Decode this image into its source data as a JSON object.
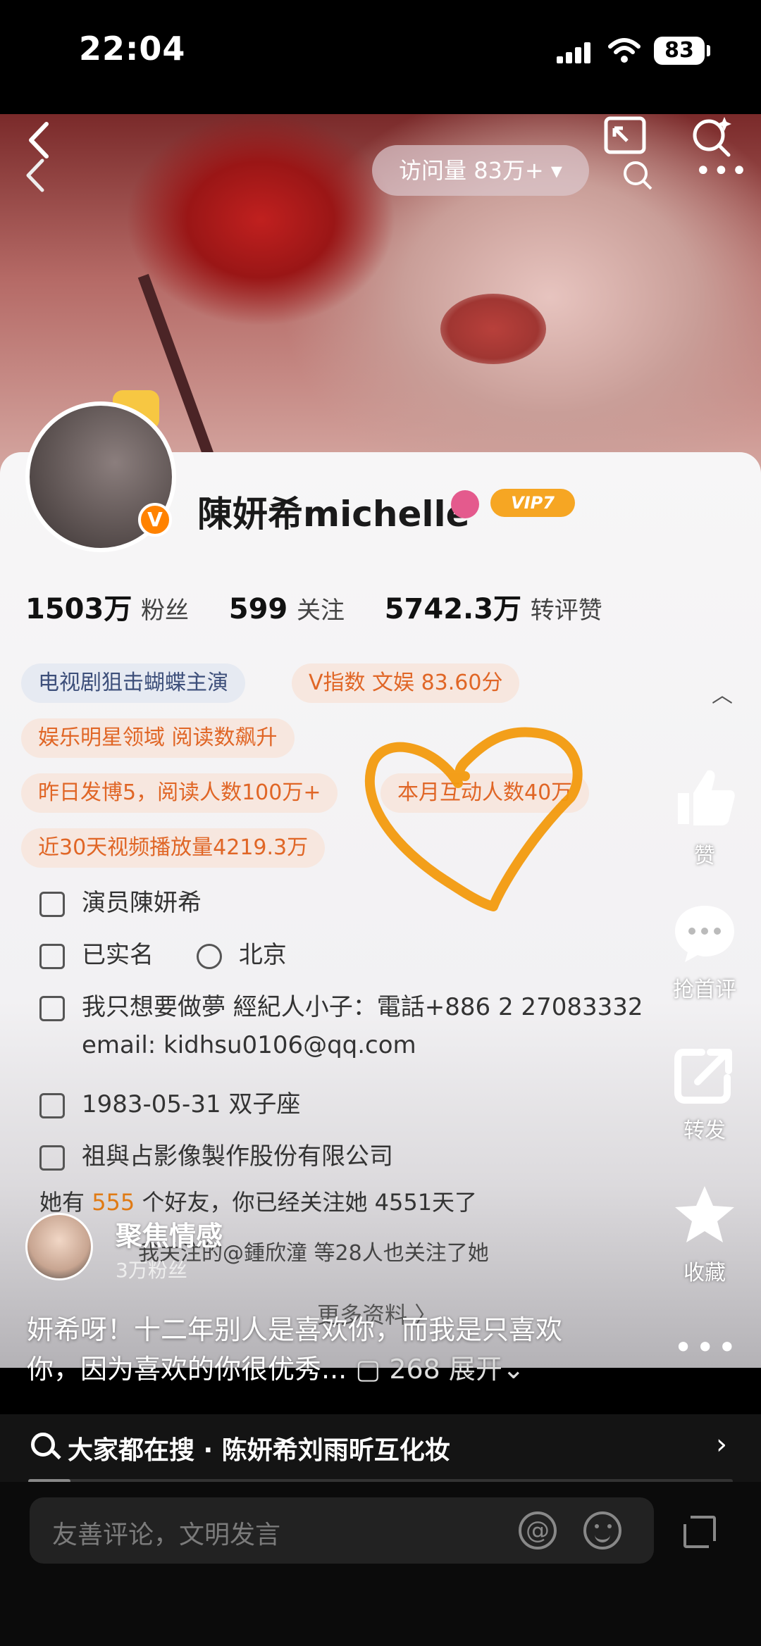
{
  "status_bar": {
    "time": "22:04",
    "battery": "83"
  },
  "nav": {
    "visits": "访问量 83万+ ▾"
  },
  "profile": {
    "name": "陳妍希michelle",
    "vip": "VIP7",
    "fans_count": "1503万",
    "fans_label": "粉丝",
    "following_count": "599",
    "following_label": "关注",
    "likes_count": "5742.3万",
    "likes_label": "转评赞",
    "tags": [
      "电视剧狙击蝴蝶主演",
      "V指数 文娱 83.60分",
      "娱乐明星领域 阅读数飙升",
      "昨日发博5，阅读人数100万+",
      "本月互动人数40万",
      "近30天视频播放量4219.3万"
    ],
    "info": {
      "verified": "演员陳妍希",
      "realname": "已实名",
      "ip": "北京",
      "bio_line1": "我只想要做夢 經紀人小子：電話+886 2 27083332",
      "bio_line2": "email: kidhsu0106@qq.com",
      "birthday": "1983-05-31 双子座",
      "company": "祖與占影像製作股份有限公司"
    },
    "friends_prefix": "她有",
    "friends_count": "555",
    "friends_suffix": "个好友，你已经关注她 4551天了",
    "mutual_follow": "我关注的@鍾欣潼 等28人也关注了她",
    "more_info": "更多资料 〉"
  },
  "actions": {
    "like": "赞",
    "comment": "抢首评",
    "share": "转发",
    "favorite": "收藏"
  },
  "uploader": {
    "name": "聚焦情感",
    "fans": "3万粉丝"
  },
  "caption": {
    "text": "妍希呀！十二年别人是喜欢你，而我是只喜欢你，因为喜欢的你很优秀...",
    "meta": "▢ 268 展开⌄"
  },
  "search": {
    "text": "大家都在搜 · 陈妍希刘雨昕互化妆"
  },
  "progress": {
    "fraction": 0.06
  },
  "comment": {
    "placeholder": "友善评论，文明发言"
  },
  "colors": {
    "orange_tag": "#e06626",
    "blue_tag": "#3d4f7a",
    "heart": "#f29a0e"
  }
}
